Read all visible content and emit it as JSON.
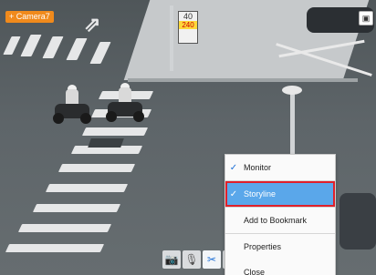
{
  "camera": {
    "label": "+ Camera7"
  },
  "sign": {
    "line1": "40",
    "line2": "240"
  },
  "context_menu": {
    "items": [
      {
        "label": "Monitor",
        "checked": true
      },
      {
        "label": "Storyline",
        "checked": true,
        "highlighted": true
      },
      {
        "label": "Add to Bookmark",
        "checked": false
      },
      {
        "label": "Properties",
        "checked": false
      },
      {
        "label": "Close",
        "checked": false
      }
    ]
  },
  "toolbar": {
    "icons": [
      "camera-snapshot-icon",
      "microphone-icon",
      "tools-icon",
      "speaker-icon"
    ]
  },
  "colors": {
    "highlight": "#5aa7ea",
    "highlight_border": "#e0202a",
    "camera_label_bg": "#f08a1c",
    "accent": "#1d6fd6"
  }
}
